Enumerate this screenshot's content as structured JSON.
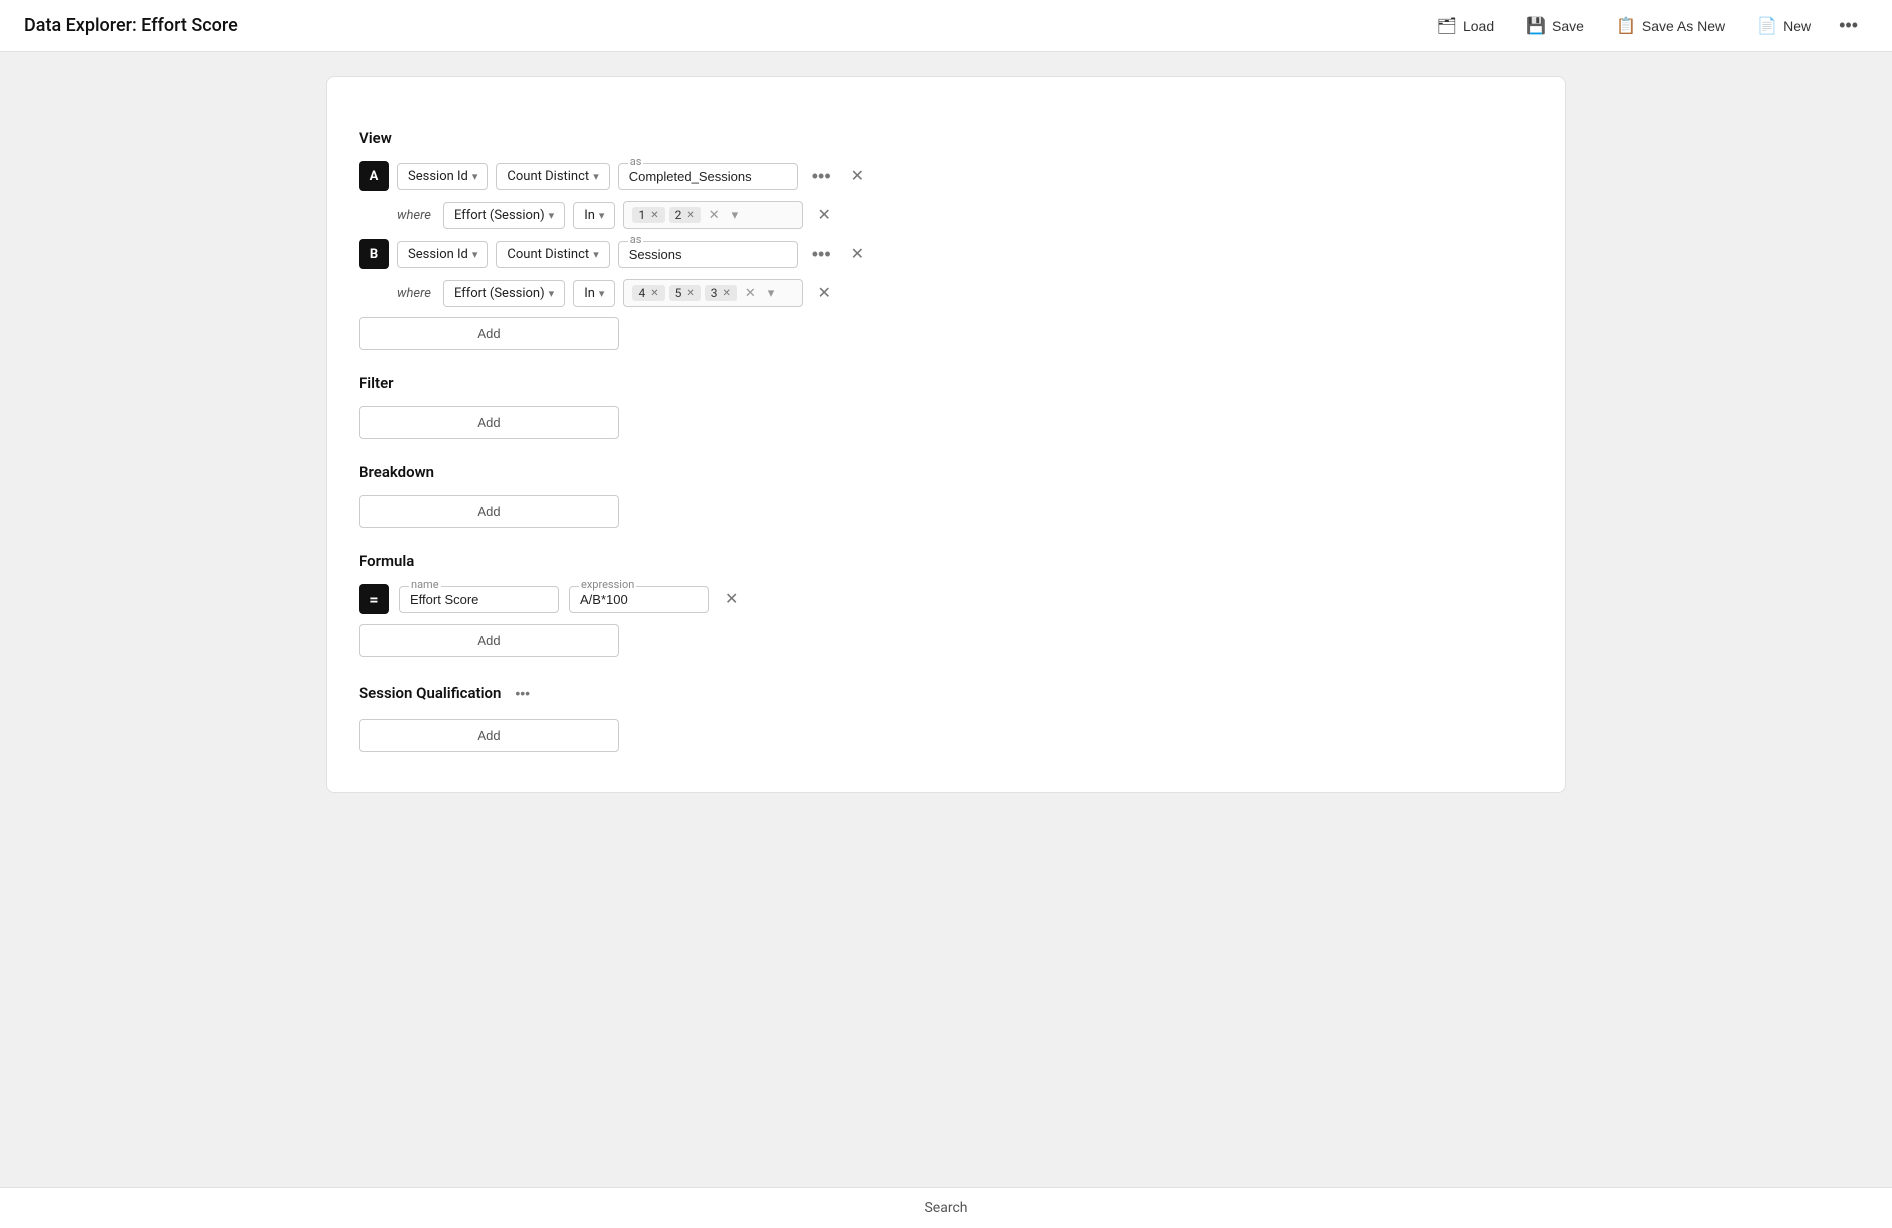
{
  "header": {
    "title": "Data Explorer: Effort Score",
    "load_label": "Load",
    "save_label": "Save",
    "save_as_new_label": "Save As New",
    "new_label": "New"
  },
  "view": {
    "section_label": "View",
    "row_a": {
      "badge": "A",
      "field": "Session Id",
      "aggregation": "Count Distinct",
      "as_label": "as",
      "as_value": "Completed_Sessions",
      "where_label": "where",
      "where_field": "Effort (Session)",
      "where_op": "In",
      "tags": [
        "1",
        "2"
      ]
    },
    "row_b": {
      "badge": "B",
      "field": "Session Id",
      "aggregation": "Count Distinct",
      "as_label": "as",
      "as_value": "Sessions",
      "where_label": "where",
      "where_field": "Effort (Session)",
      "where_op": "In",
      "tags": [
        "4",
        "5",
        "3"
      ]
    },
    "add_label": "Add"
  },
  "filter": {
    "section_label": "Filter",
    "add_label": "Add"
  },
  "breakdown": {
    "section_label": "Breakdown",
    "add_label": "Add"
  },
  "formula": {
    "section_label": "Formula",
    "badge": "=",
    "name_label": "name",
    "name_value": "Effort Score",
    "expression_label": "expression",
    "expression_value": "A/B*100",
    "add_label": "Add"
  },
  "session_qualification": {
    "section_label": "Session Qualification",
    "add_label": "Add"
  },
  "search": {
    "label": "Search"
  }
}
